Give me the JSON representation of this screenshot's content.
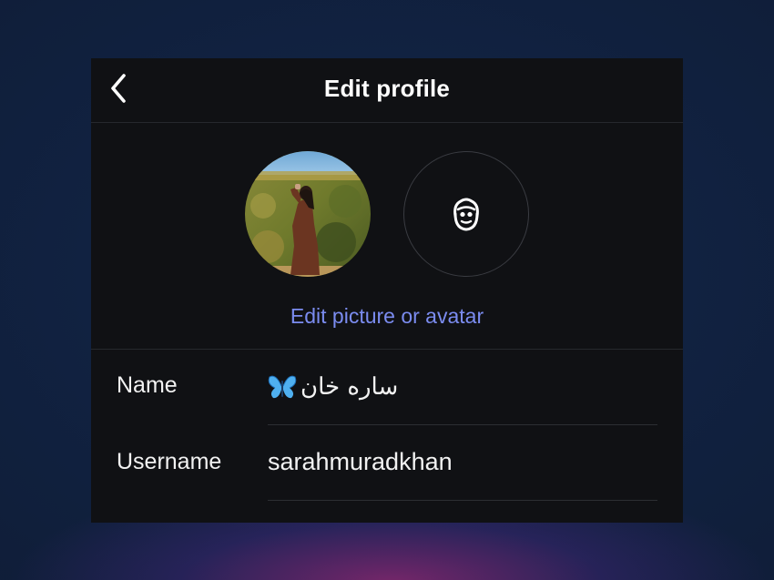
{
  "header": {
    "title": "Edit profile",
    "back_icon": "chevron-left-icon"
  },
  "avatars": {
    "photo_label": "profile-photo",
    "avatar_icon": "avatar-face-icon"
  },
  "edit_link": "Edit picture or avatar",
  "fields": {
    "name": {
      "label": "Name",
      "value": "ساره خان",
      "emoji_icon": "butterfly-icon"
    },
    "username": {
      "label": "Username",
      "value": "sarahmuradkhan"
    }
  },
  "colors": {
    "accent": "#7b8cf0",
    "panel_bg": "#101114",
    "page_bg": "#12213d"
  }
}
